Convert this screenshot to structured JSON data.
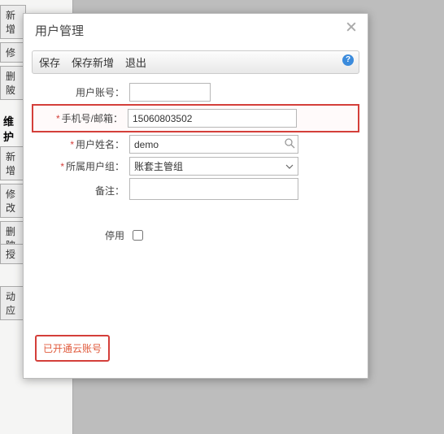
{
  "background": {
    "btn_new": "新增",
    "btn_modify": "修",
    "btn_delete": "删陂",
    "heading_maintain": "维护",
    "btn_new2": "新增",
    "btn_modify2": "修改",
    "btn_delete2": "删陂",
    "btn_auth": "授",
    "btn_dyn": "动应"
  },
  "modal": {
    "title": "用户管理",
    "toolbar": {
      "save": "保存",
      "save_new": "保存新增",
      "exit": "退出"
    },
    "form": {
      "account_label": "用户账号：",
      "account_value": "",
      "phone_label": "手机号/邮箱：",
      "phone_value": "15060803502",
      "name_label": "用户姓名：",
      "name_value": "demo",
      "group_label": "所属用户组：",
      "group_value": "账套主管组",
      "remark_label": "备注：",
      "remark_value": "",
      "disable_label": "停用"
    },
    "cloud_status": "已开通云账号"
  }
}
